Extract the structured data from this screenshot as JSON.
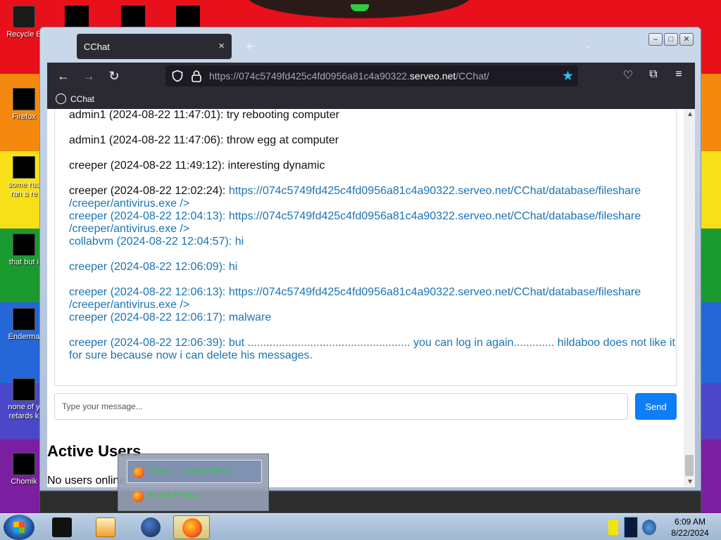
{
  "desktop": {
    "icons": [
      {
        "label": "Recycle B",
        "icon": "recycle-bin-icon"
      },
      {
        "label": "Firefox",
        "icon": "firefox-icon"
      },
      {
        "label": "some rus",
        "label2": "ran a re",
        "icon": "file-icon"
      },
      {
        "label": "that but i",
        "icon": "shortcut-icon"
      },
      {
        "label": "Enderma",
        "icon": "app-icon"
      },
      {
        "label": "none of y",
        "label2": "retards k",
        "icon": "app-icon"
      },
      {
        "label": "Chomik",
        "icon": "image-icon"
      }
    ]
  },
  "browser": {
    "tab_title": "CChat",
    "tab_close": "×",
    "new_tab": "+",
    "tab_list": "⌄",
    "url_prefix": "https://074c5749fd425c4fd0956a81c4a90322.",
    "url_host": "serveo.net",
    "url_path": "/CChat/",
    "bookmark": "CChat",
    "nav": {
      "back": "←",
      "forward": "→",
      "reload": "↻"
    },
    "toolbar_icons": {
      "pocket": "♡",
      "extensions": "⧉",
      "menu": "≡"
    }
  },
  "chat": {
    "messages": [
      {
        "who": "admin1 (2024-08-22 11:47:01): ",
        "text": "try rebooting computer"
      },
      {
        "who": "admin1 (2024-08-22 11:47:06): ",
        "text": "throw egg at computer"
      },
      {
        "who": "creeper (2024-08-22 11:49:12): ",
        "text": "interesting dynamic"
      },
      {
        "who": "creeper (2024-08-22 12:02:24): ",
        "link": "https://074c5749fd425c4fd0956a81c4a90322.serveo.net/CChat/database/fileshare",
        "text": "/creeper/antivirus.exe />"
      },
      {
        "who": "creeper (2024-08-22 12:04:13): ",
        "link": "https://074c5749fd425c4fd0956a81c4a90322.serveo.net/CChat/database/fileshare",
        "text": "/creeper/antivirus.exe />"
      },
      {
        "who": "collabvm (2024-08-22 12:04:57): ",
        "text": "hi"
      },
      {
        "who": "creeper (2024-08-22 12:06:09): ",
        "text": "hi"
      },
      {
        "who": "creeper (2024-08-22 12:06:13): ",
        "link": "https://074c5749fd425c4fd0956a81c4a90322.serveo.net/CChat/database/fileshare",
        "text": "/creeper/antivirus.exe />"
      },
      {
        "who": "creeper (2024-08-22 12:06:17): ",
        "text": "malware"
      },
      {
        "who": "creeper (2024-08-22 12:06:39): ",
        "text": "but .................................................... you can log in again............. hildaboo does not like it for sure because now i can delete his messages."
      }
    ],
    "input_placeholder": "Type your message...",
    "send_label": "Send",
    "active_users_title": "Active Users",
    "no_users_text": "No users online"
  },
  "taskbar_popup": {
    "items": [
      {
        "label": "CChat — Mozilla Firefox"
      },
      {
        "label": "Mozilla Firefox"
      }
    ]
  },
  "taskbar": {
    "time": "6:09 AM",
    "date": "8/22/2024"
  },
  "colors": {
    "link_blue": "#1a73b5",
    "send_button": "#0d7ef3",
    "firefox_toolbar": "#2b2a33",
    "bookmark_star": "#2ac3f0"
  }
}
